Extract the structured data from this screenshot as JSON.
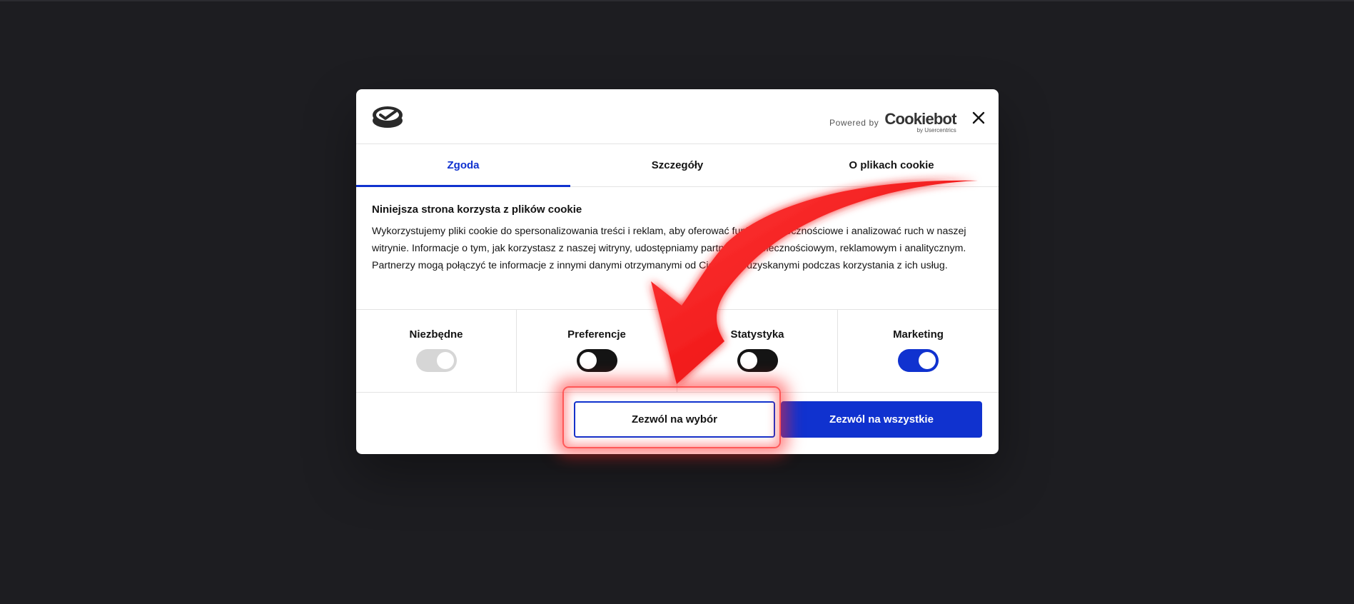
{
  "header": {
    "powered_by": "Powered by",
    "brand_name": "Cookiebot",
    "brand_sub": "by Usercentrics"
  },
  "tabs": [
    {
      "label": "Zgoda",
      "active": true
    },
    {
      "label": "Szczegóły",
      "active": false
    },
    {
      "label": "O plikach cookie",
      "active": false
    }
  ],
  "content": {
    "title": "Niniejsza strona korzysta z plików cookie",
    "body": "Wykorzystujemy pliki cookie do spersonalizowania treści i reklam, aby oferować funkcje społecznościowe i analizować ruch w naszej witrynie. Informacje o tym, jak korzystasz z naszej witryny, udostępniamy partnerom społecznościowym, reklamowym i analitycznym. Partnerzy mogą połączyć te informacje z innymi danymi otrzymanymi od Ciebie lub uzyskanymi podczas korzystania z ich usług."
  },
  "toggles": [
    {
      "label": "Niezbędne",
      "state": "on",
      "disabled": true
    },
    {
      "label": "Preferencje",
      "state": "off",
      "disabled": false
    },
    {
      "label": "Statystyka",
      "state": "off",
      "disabled": false
    },
    {
      "label": "Marketing",
      "state": "on",
      "disabled": false
    }
  ],
  "buttons": {
    "allow_selection": "Zezwól na wybór",
    "allow_all": "Zezwól na wszystkie"
  },
  "colors": {
    "accent": "#1032cf",
    "background": "#1d1d21",
    "annotation": "#ff0000"
  },
  "icons": {
    "logo": "cookiebot-logo-icon",
    "close": "close-icon",
    "annotation": "red-arrow-icon"
  }
}
